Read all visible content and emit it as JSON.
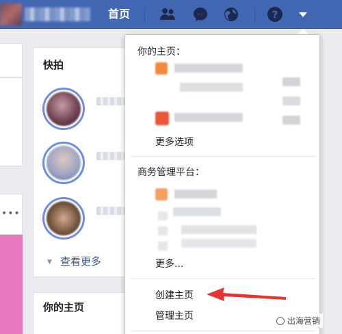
{
  "colors": {
    "brand": "#4267b2",
    "link": "#365899",
    "annotation": "#e8332f"
  },
  "header": {
    "home_label": "首页",
    "icons": [
      "friends-icon",
      "messenger-icon",
      "globe-icon",
      "help-icon",
      "dropdown-caret-icon"
    ]
  },
  "sidebar": {
    "snapshots_title": "快拍",
    "see_more_label": "查看更多",
    "your_pages_title": "你的主页"
  },
  "dropdown": {
    "your_pages_title": "你的主页：",
    "more_options_label": "更多选项",
    "business_title": "商务管理平台：",
    "more_truncated_label": "更多...",
    "create_page_label": "创建主页",
    "manage_pages_label": "管理主页"
  },
  "watermark": {
    "text": "出海营销"
  }
}
